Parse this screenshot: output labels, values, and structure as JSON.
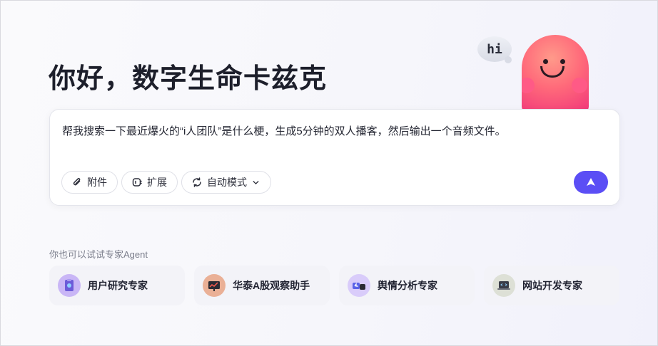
{
  "greeting": "你好，数字生命卡兹克",
  "mascot": {
    "bubble_text": "hi"
  },
  "prompt": {
    "text": "帮我搜索一下最近爆火的“i人团队”是什么梗，生成5分钟的双人播客，然后输出一个音频文件。"
  },
  "toolbar": {
    "attach_label": "附件",
    "extend_label": "扩展",
    "mode_label": "自动模式"
  },
  "agents": {
    "title": "你也可以试试专家Agent",
    "items": [
      {
        "label": "用户研究专家",
        "icon": "clipboard-avatar-icon",
        "color": "#b9a3f3"
      },
      {
        "label": "华泰A股观察助手",
        "icon": "stock-board-avatar-icon",
        "color": "#e8a58a"
      },
      {
        "label": "舆情分析专家",
        "icon": "thumbs-avatar-icon",
        "color": "#c7b4f7"
      },
      {
        "label": "网站开发专家",
        "icon": "laptop-avatar-icon",
        "color": "#d7d9cf"
      }
    ]
  },
  "colors": {
    "accent": "#5b4ef5"
  }
}
